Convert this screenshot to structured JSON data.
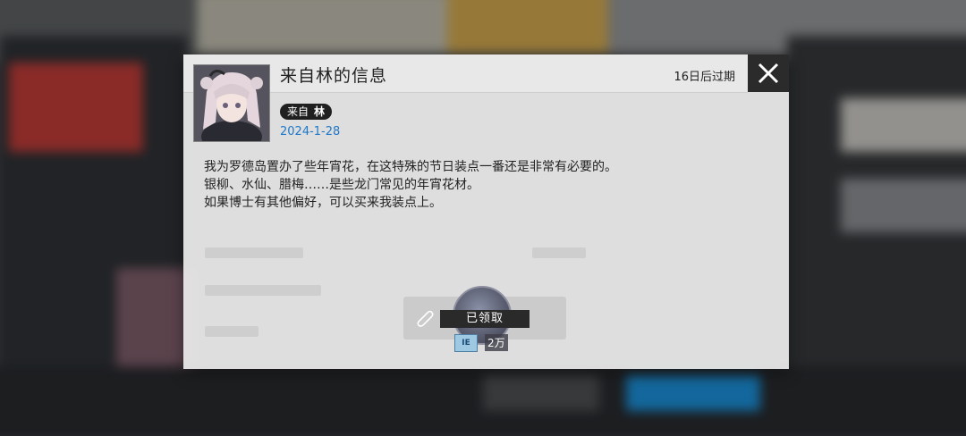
{
  "dialog": {
    "title": "来自林的信息",
    "expire": "16日后过期",
    "sender_prefix": "来自",
    "sender_name": "林",
    "date": "2024-1-28",
    "body": [
      "我为罗德岛置办了些年宵花，在这特殊的节日装点一番还是非常有必要的。",
      "银柳、水仙、腊梅……是些龙门常见的年宵花材。",
      "如果博士有其他偏好，可以买来我装点上。"
    ],
    "attachment": {
      "status": "已领取",
      "count": "2万",
      "icon_label": "IE"
    }
  },
  "icons": {
    "close": "close-icon",
    "clip": "paperclip-icon",
    "avatar": "character-avatar"
  },
  "colors": {
    "close_bg": "#2b2b2b",
    "date": "#1e78c8",
    "tag_bg": "#1f1f1f"
  }
}
